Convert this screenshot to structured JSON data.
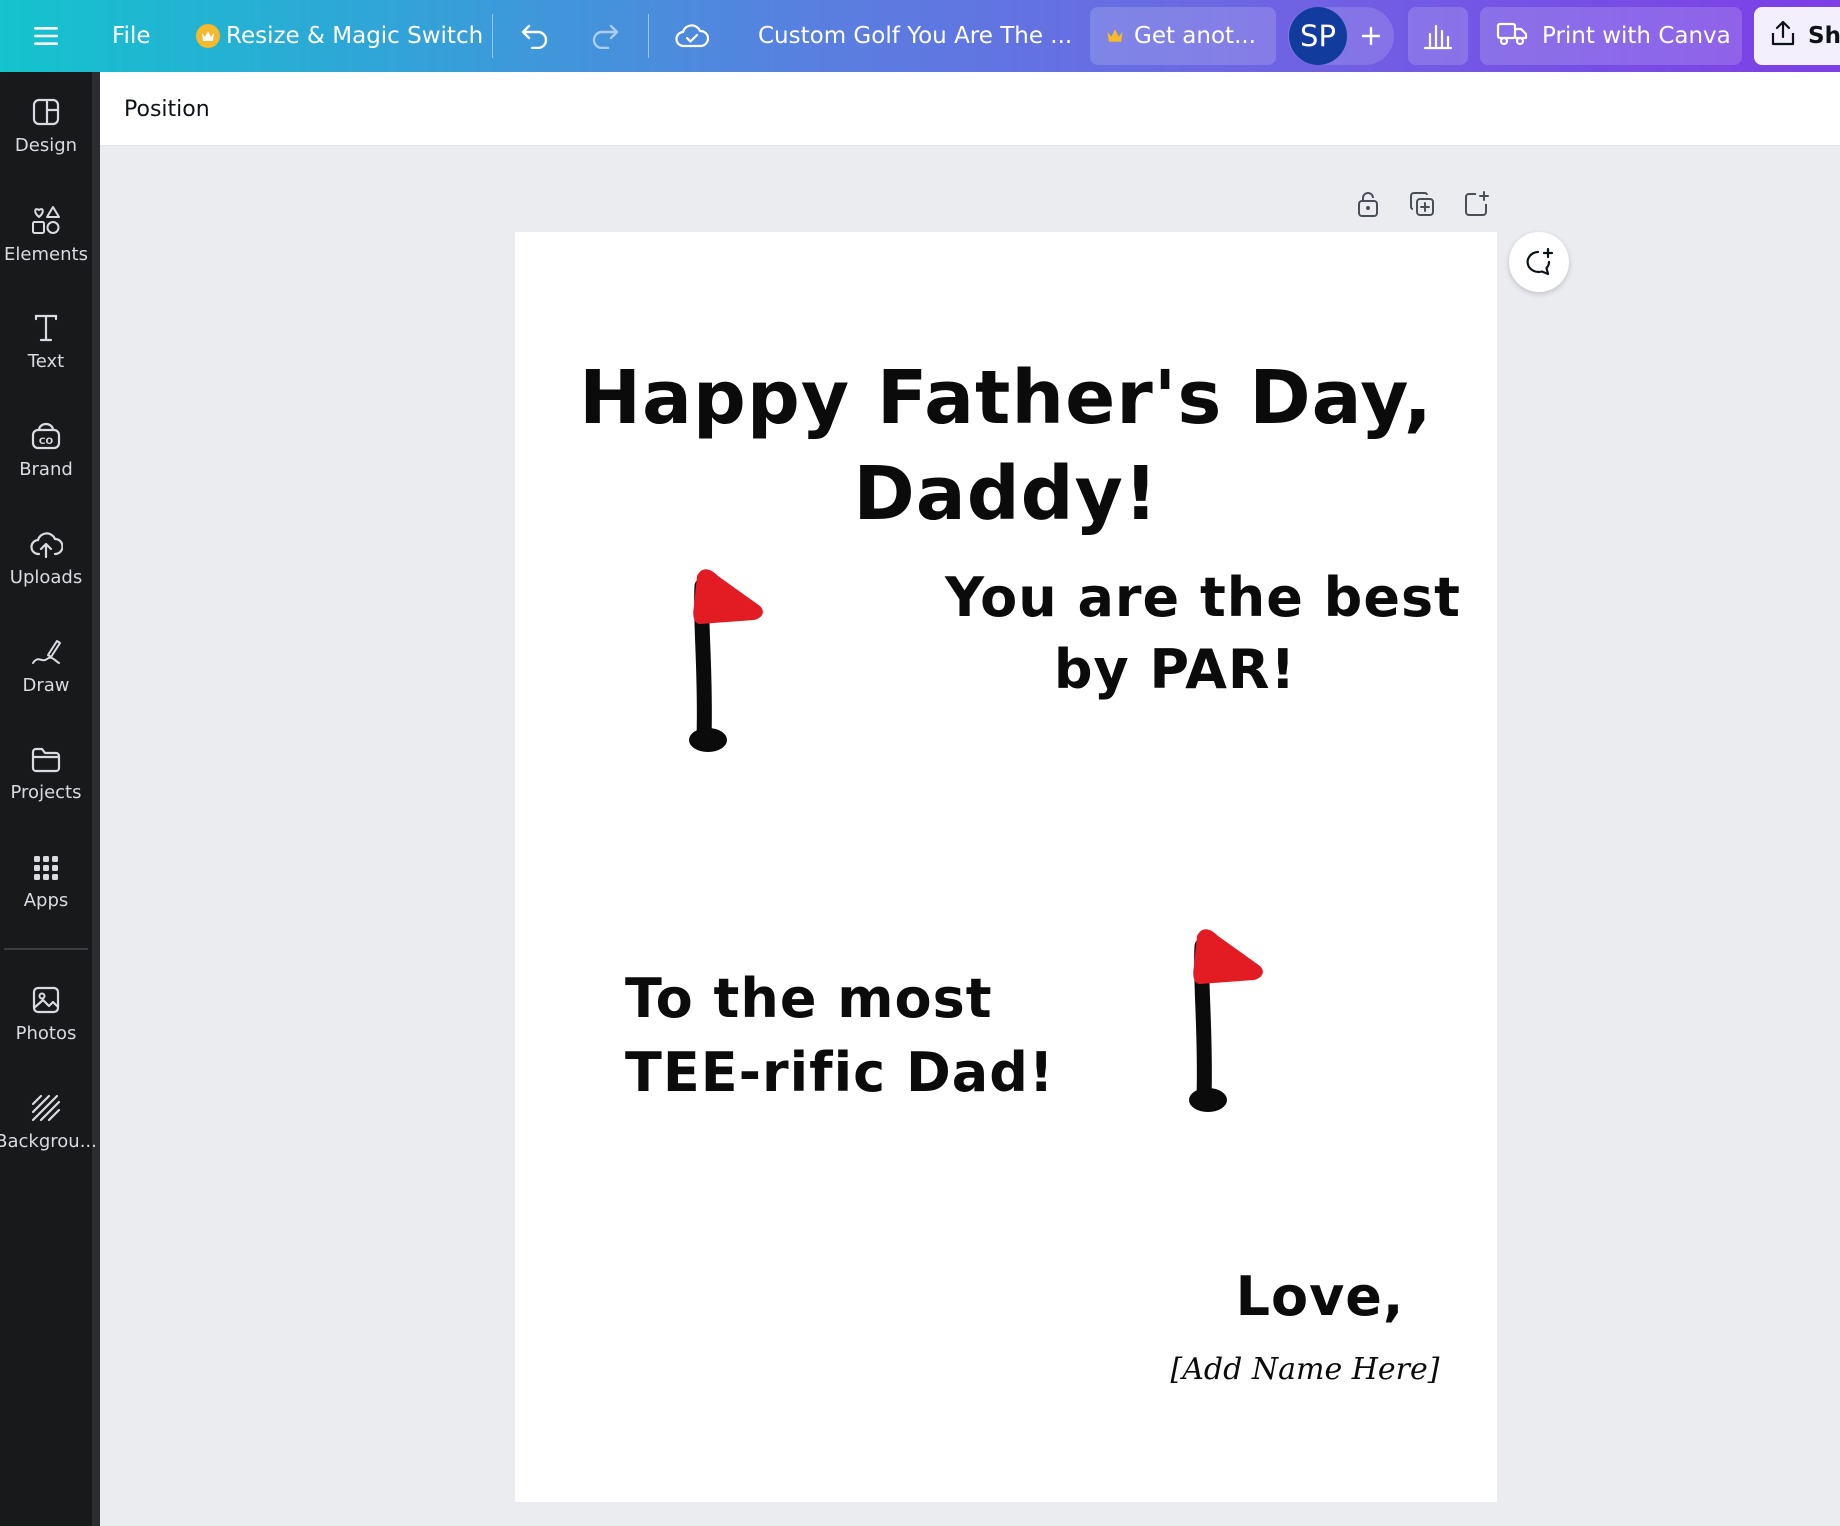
{
  "topbar": {
    "file_label": "File",
    "resize_label": "Resize & Magic Switch",
    "doc_title": "Custom Golf You Are The ...",
    "get_another_label": "Get anot...",
    "avatar_initials": "SP",
    "print_label": "Print with Canva",
    "share_label": "Sh"
  },
  "sidebar": {
    "items": [
      {
        "label": "Design",
        "icon": "layout-icon"
      },
      {
        "label": "Elements",
        "icon": "shapes-icon"
      },
      {
        "label": "Text",
        "icon": "text-icon"
      },
      {
        "label": "Brand",
        "icon": "brand-icon"
      },
      {
        "label": "Uploads",
        "icon": "cloud-upload-icon"
      },
      {
        "label": "Draw",
        "icon": "pen-icon"
      },
      {
        "label": "Projects",
        "icon": "folder-icon"
      },
      {
        "label": "Apps",
        "icon": "apps-grid-icon"
      },
      {
        "label": "Photos",
        "icon": "photo-icon"
      },
      {
        "label": "Backgrou...",
        "icon": "background-icon"
      }
    ]
  },
  "contextbar": {
    "position_label": "Position"
  },
  "card": {
    "headline_line1": "Happy Father's Day,",
    "headline_line2": "Daddy!",
    "best_line1": "You are the best",
    "best_line2": "by PAR!",
    "tee_line1": "To the most",
    "tee_line2": "TEE-rific Dad!",
    "love": "Love,",
    "name_placeholder": "[Add Name Here]"
  },
  "colors": {
    "flag_red": "#e31b23",
    "pole_black": "#0b0b0b",
    "sidebar_bg": "#18191b",
    "canvas_bg": "#ebecf0"
  }
}
